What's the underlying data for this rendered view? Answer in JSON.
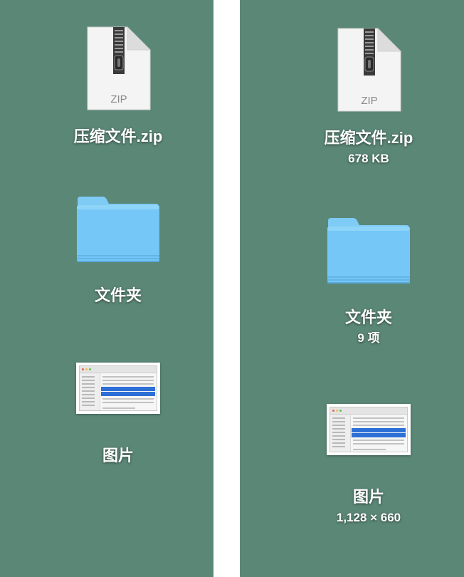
{
  "left_pane": {
    "zip": {
      "name": "压缩文件.zip",
      "badge": "ZIP"
    },
    "folder": {
      "name": "文件夹"
    },
    "image": {
      "name": "图片"
    }
  },
  "right_pane": {
    "zip": {
      "name": "压缩文件.zip",
      "badge": "ZIP",
      "info": "678 KB"
    },
    "folder": {
      "name": "文件夹",
      "info": "9 项"
    },
    "image": {
      "name": "图片",
      "info": "1,128 × 660"
    }
  },
  "icons": {
    "zip": "zip-archive-icon",
    "folder": "folder-icon",
    "image": "image-thumbnail-icon"
  },
  "colors": {
    "desktop_background": "#5b8777",
    "divider": "#ffffff",
    "folder_blue": "#6cc6f7",
    "selection_blue": "#2d6fd6"
  }
}
